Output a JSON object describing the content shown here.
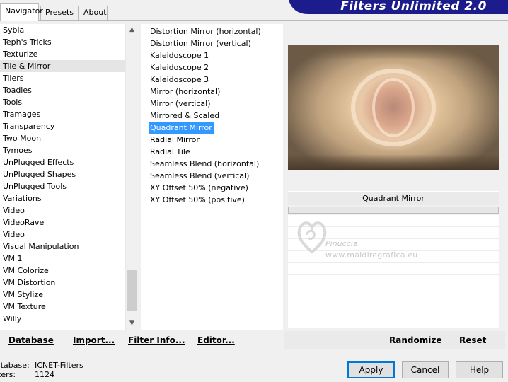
{
  "tabs": {
    "navigator": "Navigator",
    "presets": "Presets",
    "about": "About"
  },
  "banner": {
    "title": "Filters Unlimited 2.0",
    "color": "#1c1c8c"
  },
  "categories": [
    "Sybia",
    "Teph's Tricks",
    "Texturize",
    "Tile & Mirror",
    "Tilers",
    "Toadies",
    "Tools",
    "Tramages",
    "Transparency",
    "Two Moon",
    "Tymoes",
    "UnPlugged Effects",
    "UnPlugged Shapes",
    "UnPlugged Tools",
    "Variations",
    "Video",
    "VideoRave",
    "Video",
    "Visual Manipulation",
    "VM 1",
    "VM Colorize",
    "VM Distortion",
    "VM Stylize",
    "VM Texture",
    "Willy"
  ],
  "selected_category": "Tile & Mirror",
  "filters": [
    "Distortion Mirror (horizontal)",
    "Distortion Mirror (vertical)",
    "Kaleidoscope 1",
    "Kaleidoscope 2",
    "Kaleidoscope 3",
    "Mirror (horizontal)",
    "Mirror (vertical)",
    "Mirrored & Scaled",
    "Quadrant Mirror",
    "Radial Mirror",
    "Radial Tile",
    "Seamless Blend (horizontal)",
    "Seamless Blend (vertical)",
    "XY Offset 50% (negative)",
    "XY Offset 50% (positive)"
  ],
  "selected_filter": "Quadrant Mirror",
  "preview": {
    "filter_name": "Quadrant Mirror"
  },
  "watermark": {
    "name": "Pinuccia",
    "url": "www.maldiregrafica.eu"
  },
  "bottom_links": {
    "database": "Database",
    "import": "Import...",
    "filter_info": "Filter Info...",
    "editor": "Editor...",
    "randomize": "Randomize",
    "reset": "Reset"
  },
  "status": {
    "database_label": "atabase:",
    "database_value": "ICNET-Filters",
    "filters_label": "lters:",
    "filters_value": "1124"
  },
  "buttons": {
    "apply": "Apply",
    "cancel": "Cancel",
    "help": "Help"
  },
  "colors": {
    "selection": "#3399ff",
    "accent": "#0078d7"
  }
}
